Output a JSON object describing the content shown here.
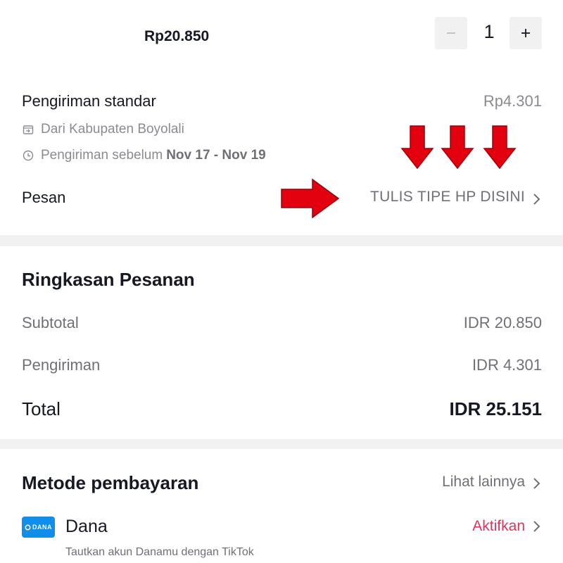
{
  "product": {
    "price": "Rp20.850",
    "quantity": "1",
    "minus_symbol": "−",
    "plus_symbol": "+"
  },
  "shipping": {
    "title": "Pengiriman standar",
    "price": "Rp4.301",
    "origin": "Dari Kabupaten Boyolali",
    "eta_prefix": "Pengiriman sebelum",
    "eta_range": "Nov 17 - Nov 19"
  },
  "message": {
    "label": "Pesan",
    "value": "TULIS TIPE HP DISINI"
  },
  "summary": {
    "title": "Ringkasan Pesanan",
    "subtotal_label": "Subtotal",
    "subtotal_value": "IDR 20.850",
    "shipping_label": "Pengiriman",
    "shipping_value": "IDR 4.301",
    "total_label": "Total",
    "total_value": "IDR 25.151"
  },
  "payment": {
    "title": "Metode pembayaran",
    "see_more": "Lihat lainnya",
    "method_logo_text": "DANA",
    "method_name": "Dana",
    "method_action": "Aktifkan",
    "method_hint": "Tautkan akun Danamu dengan TikTok"
  },
  "colors": {
    "annotation_arrow": "#e3000f",
    "accent_action": "#e3315a",
    "dana_brand": "#118ee9",
    "divider_band": "#f1f1f2"
  },
  "icons": {
    "origin": "package-arrow-icon",
    "eta": "clock-icon",
    "chevron": "chevron-right-icon"
  }
}
